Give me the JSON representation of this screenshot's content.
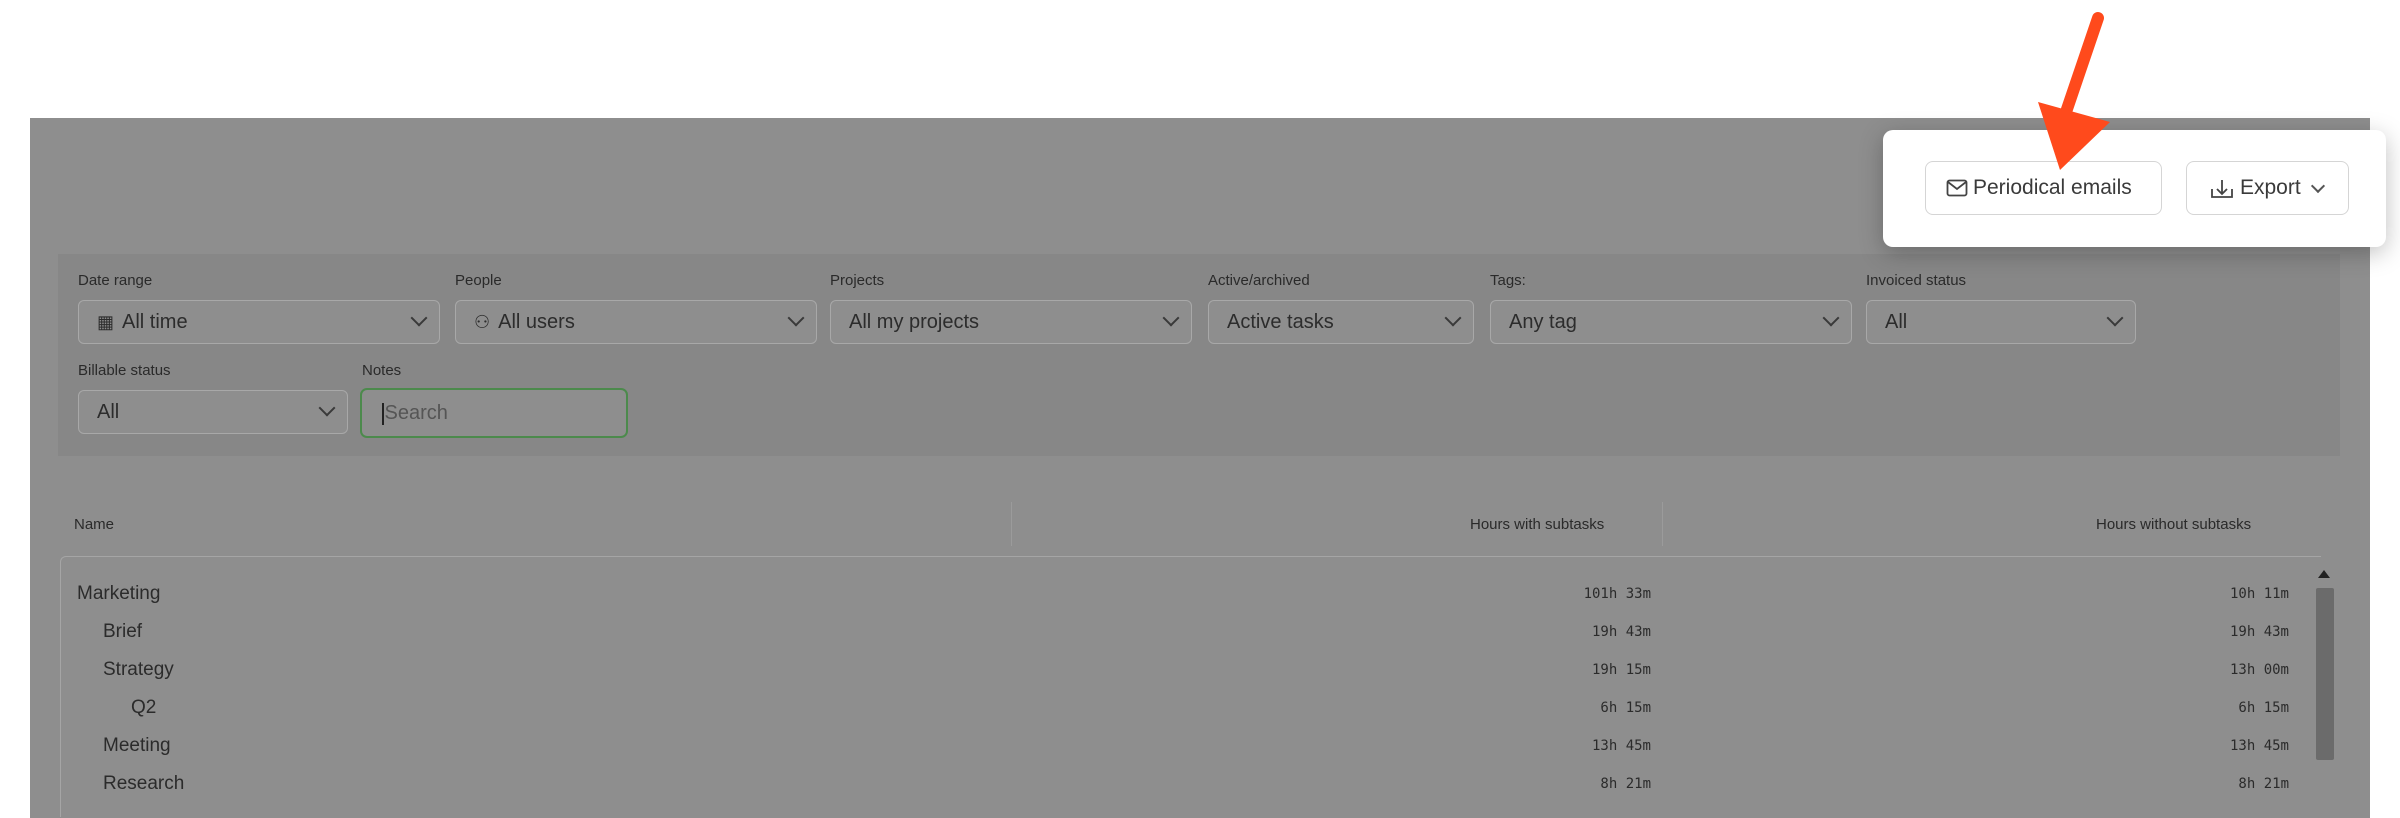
{
  "filters": {
    "date_range": {
      "label": "Date range",
      "value": "All time",
      "icon": "calendar-icon"
    },
    "people": {
      "label": "People",
      "value": "All users",
      "icon": "users-icon"
    },
    "projects": {
      "label": "Projects",
      "value": "All my projects"
    },
    "active_archived": {
      "label": "Active/archived",
      "value": "Active tasks"
    },
    "tags": {
      "label": "Tags:",
      "value": "Any tag"
    },
    "invoiced_status": {
      "label": "Invoiced status",
      "value": "All"
    },
    "billable_status": {
      "label": "Billable status",
      "value": "All"
    },
    "notes": {
      "label": "Notes",
      "placeholder": "Search"
    }
  },
  "table": {
    "columns": [
      "Name",
      "Hours with subtasks",
      "Hours without subtasks"
    ],
    "rows": [
      {
        "name": "Marketing",
        "with_subtasks": "101h 33m",
        "without_subtasks": "10h 11m",
        "level": 0
      },
      {
        "name": "Brief",
        "with_subtasks": "19h 43m",
        "without_subtasks": "19h 43m",
        "level": 1
      },
      {
        "name": "Strategy",
        "with_subtasks": "19h 15m",
        "without_subtasks": "13h 00m",
        "level": 1
      },
      {
        "name": "Q2",
        "with_subtasks": "6h 15m",
        "without_subtasks": "6h 15m",
        "level": 2
      },
      {
        "name": "Meeting",
        "with_subtasks": "13h 45m",
        "without_subtasks": "13h 45m",
        "level": 1
      },
      {
        "name": "Research",
        "with_subtasks": "8h 21m",
        "without_subtasks": "8h 21m",
        "level": 1
      }
    ]
  },
  "popover": {
    "periodical_emails_label": "Periodical emails",
    "export_label": "Export"
  },
  "colors": {
    "highlight_arrow": "#FF4A1C",
    "notes_focus_border": "#4C8A4C"
  }
}
